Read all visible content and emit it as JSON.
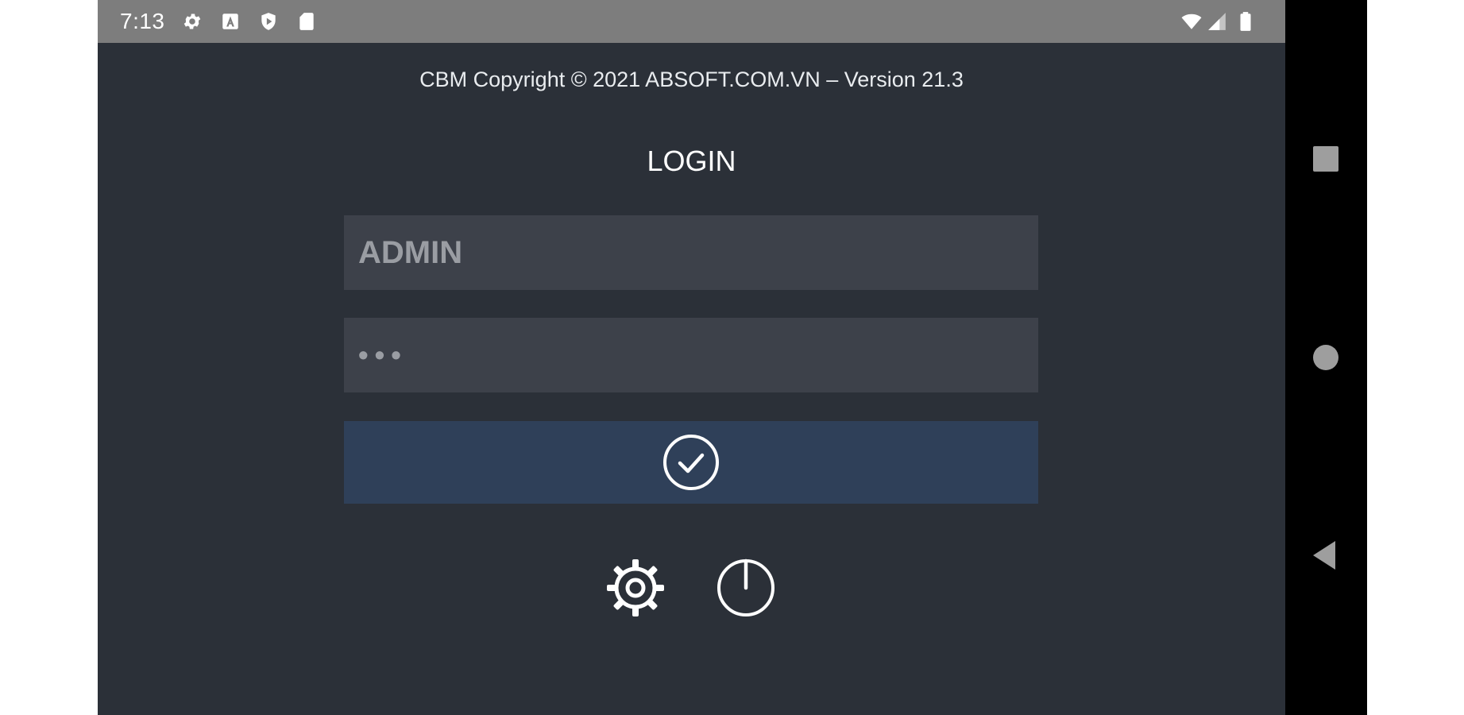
{
  "status_bar": {
    "time": "7:13",
    "left_icons": [
      "gear-icon",
      "a-box-icon",
      "shield-play-icon",
      "sd-card-icon"
    ],
    "right_icons": [
      "wifi-icon",
      "cell-signal-icon",
      "battery-icon"
    ],
    "background": "#7d7d7d"
  },
  "app": {
    "copyright": "CBM Copyright © 2021 ABSOFT.COM.VN – Version 21.3",
    "title": "LOGIN",
    "username": {
      "value": "ADMIN",
      "placeholder": "ADMIN"
    },
    "password": {
      "value": "•••",
      "masked": true
    },
    "login_button_icon": "check-circle-icon",
    "actions": [
      {
        "icon": "settings-gear-icon"
      },
      {
        "icon": "power-icon"
      }
    ],
    "colors": {
      "background": "#2b3038",
      "field": "#3d414a",
      "button": "#2f4059",
      "text": "#ffffff"
    }
  },
  "nav_bar": {
    "buttons": [
      "recents-square-icon",
      "home-circle-icon",
      "back-triangle-icon"
    ],
    "background": "#000000"
  }
}
